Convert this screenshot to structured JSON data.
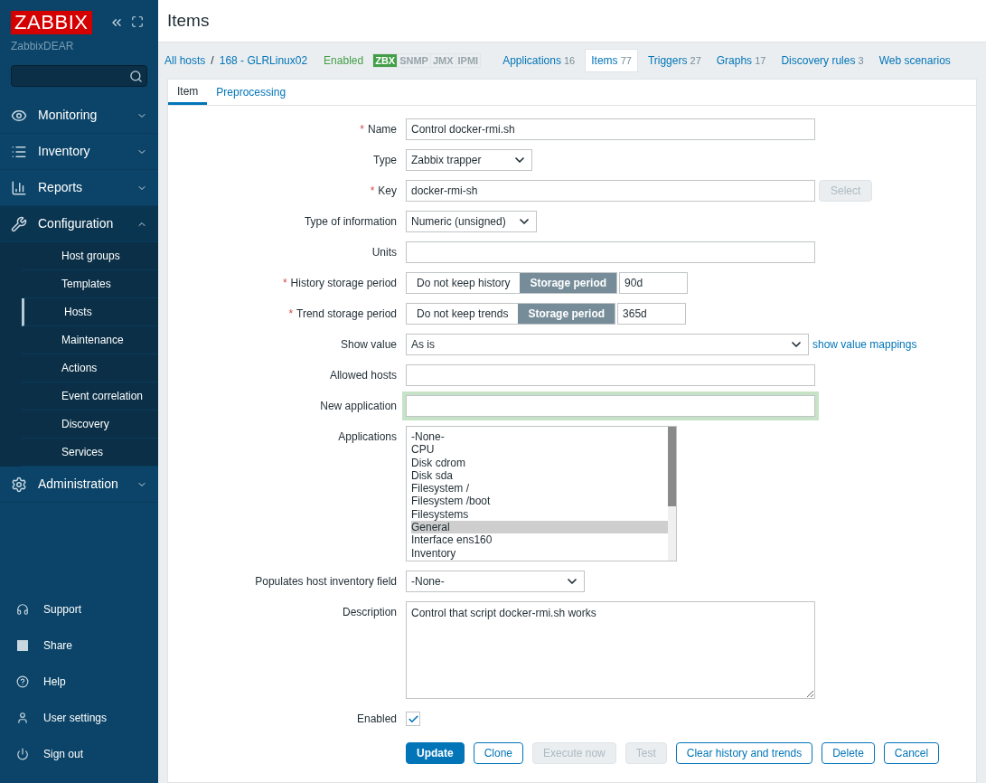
{
  "sidebar": {
    "logo": "ZABBIX",
    "server": "ZabbixDEAR",
    "menu": [
      {
        "label": "Monitoring",
        "expanded": false
      },
      {
        "label": "Inventory",
        "expanded": false
      },
      {
        "label": "Reports",
        "expanded": false
      },
      {
        "label": "Configuration",
        "expanded": true,
        "children": [
          {
            "label": "Host groups",
            "selected": false
          },
          {
            "label": "Templates",
            "selected": false
          },
          {
            "label": "Hosts",
            "selected": true
          },
          {
            "label": "Maintenance",
            "selected": false
          },
          {
            "label": "Actions",
            "selected": false
          },
          {
            "label": "Event correlation",
            "selected": false
          },
          {
            "label": "Discovery",
            "selected": false
          },
          {
            "label": "Services",
            "selected": false
          }
        ]
      },
      {
        "label": "Administration",
        "expanded": false
      }
    ],
    "footer": [
      "Support",
      "Share",
      "Help",
      "User settings",
      "Sign out"
    ]
  },
  "page": {
    "title": "Items"
  },
  "host_nav": {
    "breadcrumbs": [
      "All hosts",
      "168 - GLRLinux02"
    ],
    "separator": "/",
    "status": "Enabled",
    "availability": [
      {
        "label": "ZBX",
        "on": true
      },
      {
        "label": "SNMP",
        "on": false
      },
      {
        "label": "JMX",
        "on": false
      },
      {
        "label": "IPMI",
        "on": false
      }
    ],
    "links": [
      {
        "label": "Applications",
        "count": "16",
        "selected": false
      },
      {
        "label": "Items",
        "count": "77",
        "selected": true
      },
      {
        "label": "Triggers",
        "count": "27",
        "selected": false
      },
      {
        "label": "Graphs",
        "count": "17",
        "selected": false
      },
      {
        "label": "Discovery rules",
        "count": "3",
        "selected": false
      },
      {
        "label": "Web scenarios",
        "selected": false
      }
    ]
  },
  "form_tabs": [
    {
      "label": "Item",
      "selected": true
    },
    {
      "label": "Preprocessing",
      "selected": false
    }
  ],
  "fields": [
    {
      "kind": "text",
      "label": "Name",
      "required_mark": "*",
      "value": "Control docker-rmi.sh"
    },
    {
      "kind": "select",
      "label": "Type",
      "value": "Zabbix trapper"
    },
    {
      "kind": "text_button",
      "label": "Key",
      "required_mark": "*",
      "value": "docker-rmi-sh",
      "button": "Select"
    },
    {
      "kind": "select",
      "label": "Type of information",
      "value": "Numeric (unsigned)"
    },
    {
      "kind": "text",
      "label": "Units"
    },
    {
      "kind": "toggle",
      "label": "History storage period",
      "required_mark": "*",
      "options": [
        {
          "label": "Do not keep history",
          "selected": false
        },
        {
          "label": "Storage period",
          "selected": true
        }
      ],
      "value": "90d"
    },
    {
      "kind": "toggle",
      "label": "Trend storage period",
      "required_mark": "*",
      "options": [
        {
          "label": "Do not keep trends",
          "selected": false
        },
        {
          "label": "Storage period",
          "selected": true
        }
      ],
      "value": "365d"
    },
    {
      "kind": "select_link",
      "label": "Show value",
      "value": "As is",
      "link": "show value mappings"
    },
    {
      "kind": "text",
      "label": "Allowed hosts"
    },
    {
      "kind": "text",
      "label": "New application",
      "focused": true
    },
    {
      "kind": "listbox",
      "label": "Applications",
      "items": [
        {
          "label": "-None-",
          "selected": false
        },
        {
          "label": "CPU",
          "selected": false
        },
        {
          "label": "Disk cdrom",
          "selected": false
        },
        {
          "label": "Disk sda",
          "selected": false
        },
        {
          "label": "Filesystem /",
          "selected": false
        },
        {
          "label": "Filesystem /boot",
          "selected": false
        },
        {
          "label": "Filesystems",
          "selected": false
        },
        {
          "label": "General",
          "selected": true
        },
        {
          "label": "Interface ens160",
          "selected": false
        },
        {
          "label": "Inventory",
          "selected": false
        }
      ]
    },
    {
      "kind": "select",
      "label": "Populates host inventory field",
      "value": "-None-"
    },
    {
      "kind": "textarea",
      "label": "Description",
      "value": "Control that script docker-rmi.sh works"
    },
    {
      "kind": "checkbox",
      "label": "Enabled",
      "checked": true
    }
  ],
  "buttons": [
    {
      "label": "Update",
      "kind": "primary"
    },
    {
      "label": "Clone",
      "kind": "secondary"
    },
    {
      "label": "Execute now",
      "kind": "disabled"
    },
    {
      "label": "Test",
      "kind": "disabled"
    },
    {
      "label": "Clear history and trends",
      "kind": "secondary"
    },
    {
      "label": "Delete",
      "kind": "secondary"
    },
    {
      "label": "Cancel",
      "kind": "secondary"
    }
  ]
}
